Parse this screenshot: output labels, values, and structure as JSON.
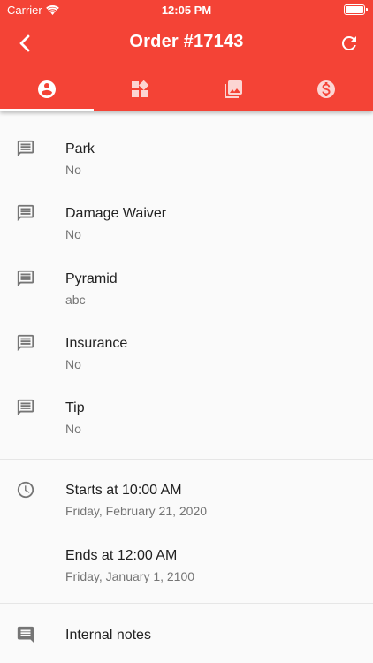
{
  "status_bar": {
    "carrier": "Carrier",
    "time": "12:05 PM"
  },
  "app_bar": {
    "title": "Order #17143",
    "back_icon": "chevron-left-icon",
    "refresh_icon": "refresh-icon"
  },
  "tabs": [
    {
      "icon": "account-circle-icon",
      "active": true
    },
    {
      "icon": "widgets-icon",
      "active": false
    },
    {
      "icon": "photo-library-icon",
      "active": false
    },
    {
      "icon": "monetization-icon",
      "active": false
    }
  ],
  "custom_fields": [
    {
      "label": "Park",
      "value": "No",
      "icon": "comment-icon"
    },
    {
      "label": "Damage Waiver",
      "value": "No",
      "icon": "comment-icon"
    },
    {
      "label": "Pyramid",
      "value": "abc",
      "icon": "comment-icon"
    },
    {
      "label": "Insurance",
      "value": "No",
      "icon": "comment-icon"
    },
    {
      "label": "Tip",
      "value": "No",
      "icon": "comment-icon"
    }
  ],
  "schedule": {
    "start": {
      "label": "Starts at 10:00 AM",
      "date": "Friday, February 21, 2020",
      "icon": "clock-icon"
    },
    "end": {
      "label": "Ends at 12:00 AM",
      "date": "Friday, January 1, 2100"
    }
  },
  "notes": {
    "label": "Internal notes",
    "icon": "notes-icon"
  },
  "colors": {
    "primary": "#f44336",
    "text_primary": "#212121",
    "text_secondary": "#757575",
    "icon": "#757575"
  }
}
